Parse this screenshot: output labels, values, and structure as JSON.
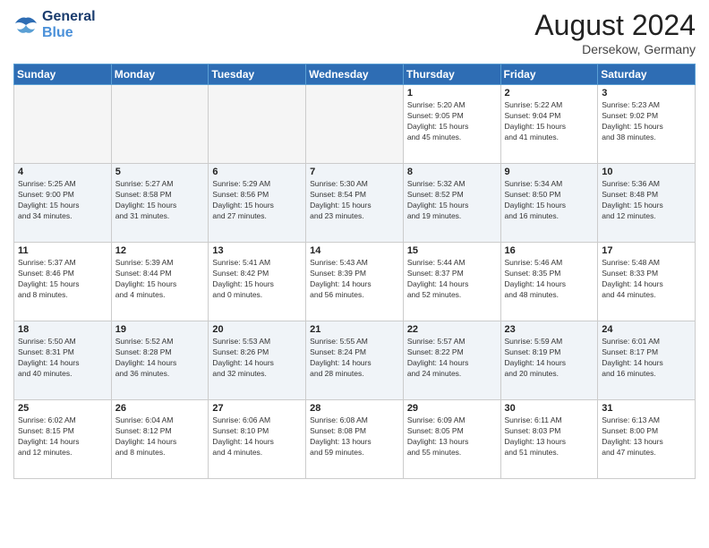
{
  "header": {
    "logo_line1": "General",
    "logo_line2": "Blue",
    "month_year": "August 2024",
    "location": "Dersekow, Germany"
  },
  "weekdays": [
    "Sunday",
    "Monday",
    "Tuesday",
    "Wednesday",
    "Thursday",
    "Friday",
    "Saturday"
  ],
  "weeks": [
    [
      {
        "day": "",
        "info": "",
        "empty": true
      },
      {
        "day": "",
        "info": "",
        "empty": true
      },
      {
        "day": "",
        "info": "",
        "empty": true
      },
      {
        "day": "",
        "info": "",
        "empty": true
      },
      {
        "day": "1",
        "info": "Sunrise: 5:20 AM\nSunset: 9:05 PM\nDaylight: 15 hours\nand 45 minutes."
      },
      {
        "day": "2",
        "info": "Sunrise: 5:22 AM\nSunset: 9:04 PM\nDaylight: 15 hours\nand 41 minutes."
      },
      {
        "day": "3",
        "info": "Sunrise: 5:23 AM\nSunset: 9:02 PM\nDaylight: 15 hours\nand 38 minutes."
      }
    ],
    [
      {
        "day": "4",
        "info": "Sunrise: 5:25 AM\nSunset: 9:00 PM\nDaylight: 15 hours\nand 34 minutes."
      },
      {
        "day": "5",
        "info": "Sunrise: 5:27 AM\nSunset: 8:58 PM\nDaylight: 15 hours\nand 31 minutes."
      },
      {
        "day": "6",
        "info": "Sunrise: 5:29 AM\nSunset: 8:56 PM\nDaylight: 15 hours\nand 27 minutes."
      },
      {
        "day": "7",
        "info": "Sunrise: 5:30 AM\nSunset: 8:54 PM\nDaylight: 15 hours\nand 23 minutes."
      },
      {
        "day": "8",
        "info": "Sunrise: 5:32 AM\nSunset: 8:52 PM\nDaylight: 15 hours\nand 19 minutes."
      },
      {
        "day": "9",
        "info": "Sunrise: 5:34 AM\nSunset: 8:50 PM\nDaylight: 15 hours\nand 16 minutes."
      },
      {
        "day": "10",
        "info": "Sunrise: 5:36 AM\nSunset: 8:48 PM\nDaylight: 15 hours\nand 12 minutes."
      }
    ],
    [
      {
        "day": "11",
        "info": "Sunrise: 5:37 AM\nSunset: 8:46 PM\nDaylight: 15 hours\nand 8 minutes."
      },
      {
        "day": "12",
        "info": "Sunrise: 5:39 AM\nSunset: 8:44 PM\nDaylight: 15 hours\nand 4 minutes."
      },
      {
        "day": "13",
        "info": "Sunrise: 5:41 AM\nSunset: 8:42 PM\nDaylight: 15 hours\nand 0 minutes."
      },
      {
        "day": "14",
        "info": "Sunrise: 5:43 AM\nSunset: 8:39 PM\nDaylight: 14 hours\nand 56 minutes."
      },
      {
        "day": "15",
        "info": "Sunrise: 5:44 AM\nSunset: 8:37 PM\nDaylight: 14 hours\nand 52 minutes."
      },
      {
        "day": "16",
        "info": "Sunrise: 5:46 AM\nSunset: 8:35 PM\nDaylight: 14 hours\nand 48 minutes."
      },
      {
        "day": "17",
        "info": "Sunrise: 5:48 AM\nSunset: 8:33 PM\nDaylight: 14 hours\nand 44 minutes."
      }
    ],
    [
      {
        "day": "18",
        "info": "Sunrise: 5:50 AM\nSunset: 8:31 PM\nDaylight: 14 hours\nand 40 minutes."
      },
      {
        "day": "19",
        "info": "Sunrise: 5:52 AM\nSunset: 8:28 PM\nDaylight: 14 hours\nand 36 minutes."
      },
      {
        "day": "20",
        "info": "Sunrise: 5:53 AM\nSunset: 8:26 PM\nDaylight: 14 hours\nand 32 minutes."
      },
      {
        "day": "21",
        "info": "Sunrise: 5:55 AM\nSunset: 8:24 PM\nDaylight: 14 hours\nand 28 minutes."
      },
      {
        "day": "22",
        "info": "Sunrise: 5:57 AM\nSunset: 8:22 PM\nDaylight: 14 hours\nand 24 minutes."
      },
      {
        "day": "23",
        "info": "Sunrise: 5:59 AM\nSunset: 8:19 PM\nDaylight: 14 hours\nand 20 minutes."
      },
      {
        "day": "24",
        "info": "Sunrise: 6:01 AM\nSunset: 8:17 PM\nDaylight: 14 hours\nand 16 minutes."
      }
    ],
    [
      {
        "day": "25",
        "info": "Sunrise: 6:02 AM\nSunset: 8:15 PM\nDaylight: 14 hours\nand 12 minutes."
      },
      {
        "day": "26",
        "info": "Sunrise: 6:04 AM\nSunset: 8:12 PM\nDaylight: 14 hours\nand 8 minutes."
      },
      {
        "day": "27",
        "info": "Sunrise: 6:06 AM\nSunset: 8:10 PM\nDaylight: 14 hours\nand 4 minutes."
      },
      {
        "day": "28",
        "info": "Sunrise: 6:08 AM\nSunset: 8:08 PM\nDaylight: 13 hours\nand 59 minutes."
      },
      {
        "day": "29",
        "info": "Sunrise: 6:09 AM\nSunset: 8:05 PM\nDaylight: 13 hours\nand 55 minutes."
      },
      {
        "day": "30",
        "info": "Sunrise: 6:11 AM\nSunset: 8:03 PM\nDaylight: 13 hours\nand 51 minutes."
      },
      {
        "day": "31",
        "info": "Sunrise: 6:13 AM\nSunset: 8:00 PM\nDaylight: 13 hours\nand 47 minutes."
      }
    ]
  ]
}
